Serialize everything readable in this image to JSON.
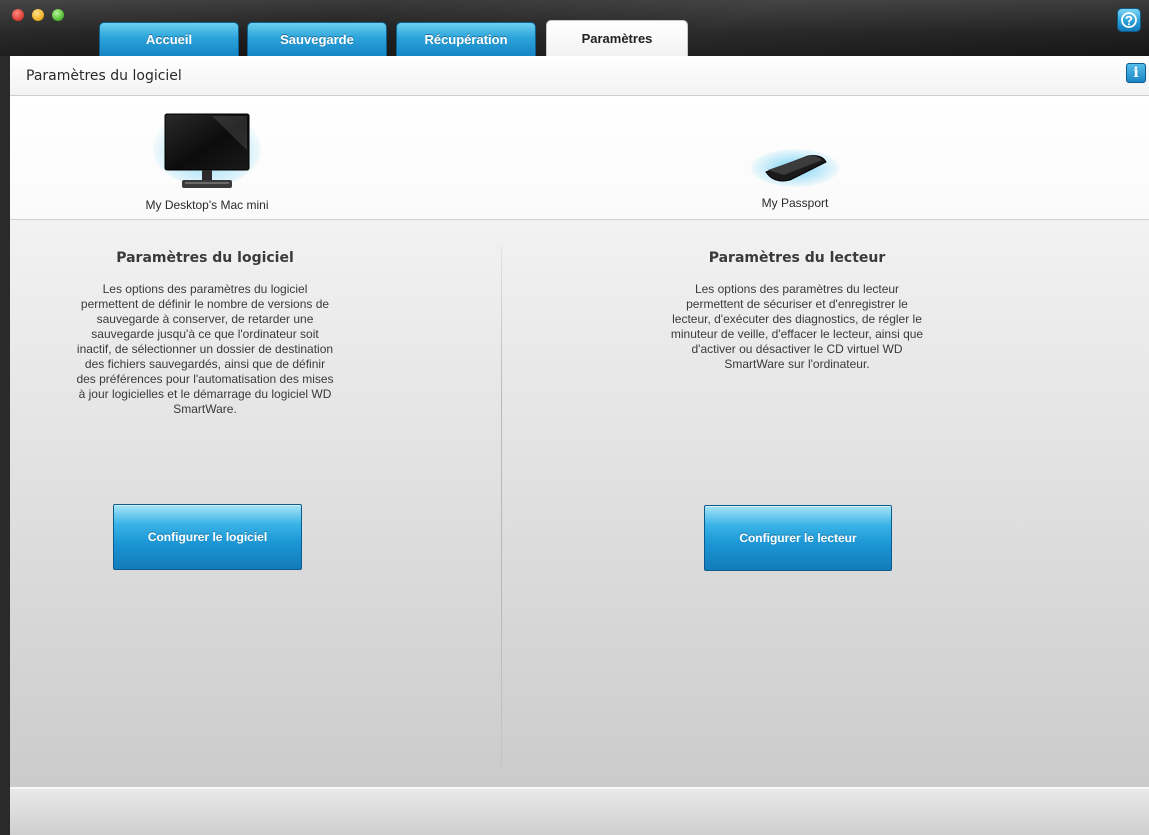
{
  "window": {
    "tabs": [
      {
        "label": "Accueil"
      },
      {
        "label": "Sauvegarde"
      },
      {
        "label": "Récupération"
      },
      {
        "label": "Paramètres"
      }
    ],
    "active_tab": "Paramètres",
    "help_icon": "help-icon"
  },
  "header": {
    "title": "Paramètres du logiciel",
    "info_icon": "info-icon",
    "info_glyph": "i"
  },
  "devices": {
    "computer": {
      "label": "My Desktop's Mac mini",
      "icon": "monitor-icon"
    },
    "drive": {
      "label": "My Passport",
      "icon": "hard-drive-icon"
    }
  },
  "software_panel": {
    "heading": "Paramètres du logiciel",
    "description": "Les options des paramètres du logiciel permettent de définir le nombre de versions de sauvegarde à conserver, de retarder une sauvegarde jusqu'à ce que l'ordinateur soit inactif, de sélectionner un dossier de destination des fichiers sauvegardés, ainsi que de définir des préférences pour l'automatisation des mises à jour logicielles et le démarrage du logiciel WD SmartWare.",
    "button": "Configurer le logiciel"
  },
  "drive_panel": {
    "heading": "Paramètres du lecteur",
    "description": "Les options des paramètres du lecteur permettent de sécuriser et d'enregistrer le lecteur, d'exécuter des diagnostics, de régler le minuteur de veille, d'effacer le lecteur, ainsi que d'activer ou désactiver le CD virtuel WD SmartWare sur l'ordinateur.",
    "button": "Configurer le lecteur"
  },
  "colors": {
    "tab_blue": "#2ba3da",
    "button_blue": "#1b95d4",
    "titlebar_dark": "#1f1f1f"
  }
}
